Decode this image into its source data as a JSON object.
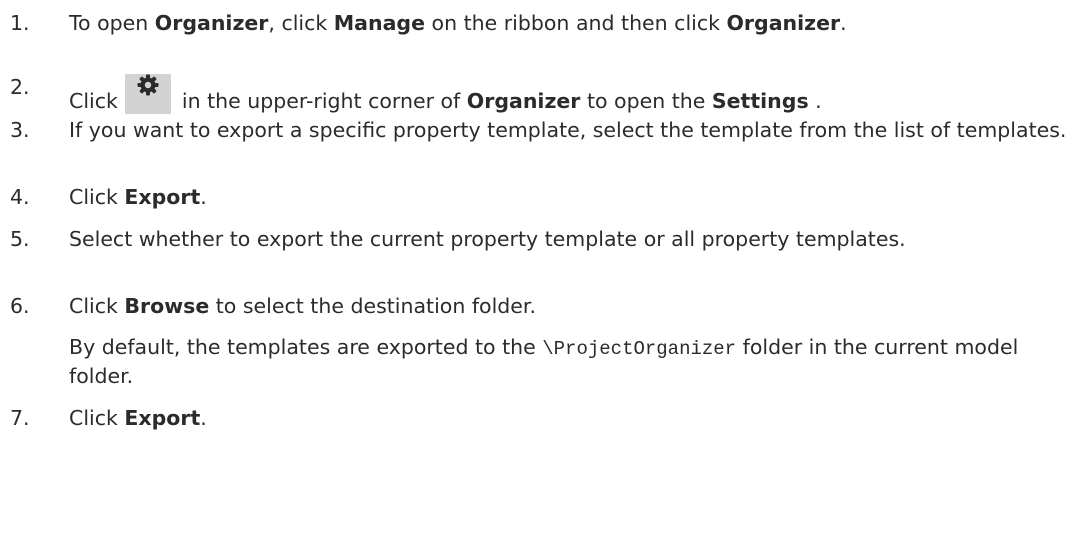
{
  "steps": [
    {
      "number": "1.",
      "parts": [
        "To open ",
        "Organizer",
        ", click ",
        "Manage",
        " on the ribbon and then click ",
        "Organizer",
        "."
      ]
    },
    {
      "number": "2.",
      "parts": [
        "Click ",
        " in the upper-right corner of ",
        "Organizer",
        " to open the ",
        "Settings",
        " ."
      ],
      "icon": "gear-icon"
    },
    {
      "number": "3.",
      "text": "If you want to export a specific property template, select the template from the list of templates."
    },
    {
      "number": "4.",
      "parts": [
        "Click ",
        "Export",
        "."
      ]
    },
    {
      "number": "5.",
      "text": "Select whether to export the current property template or all property templates."
    },
    {
      "number": "6.",
      "parts": [
        "Click ",
        "Browse",
        " to select the destination folder."
      ],
      "note_parts": [
        "By default, the templates are exported to the ",
        "\\ProjectOrganizer",
        " folder in the current model folder."
      ]
    },
    {
      "number": "7.",
      "parts": [
        "Click ",
        "Export",
        "."
      ]
    }
  ],
  "colors": {
    "text": "#2b2b2b",
    "icon_background": "#d3d3d3",
    "icon": "#2b2b2b"
  }
}
